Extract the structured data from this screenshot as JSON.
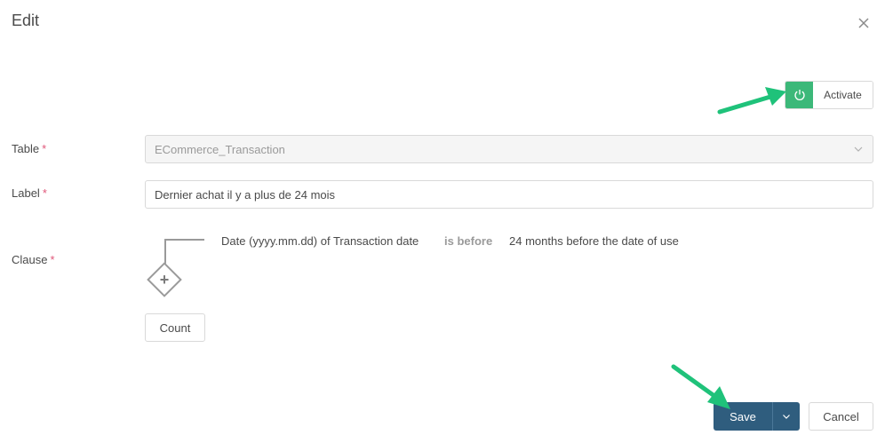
{
  "dialog": {
    "title": "Edit",
    "close_icon": "close-icon"
  },
  "activate": {
    "icon": "power-icon",
    "label": "Activate",
    "accent": "#3cb879"
  },
  "form": {
    "table": {
      "label": "Table",
      "required_mark": "*",
      "value": "ECommerce_Transaction"
    },
    "label_field": {
      "label": "Label",
      "required_mark": "*",
      "value": "Dernier achat il y a plus de 24 mois"
    },
    "clause": {
      "label": "Clause",
      "required_mark": "*",
      "field": "Date (yyyy.mm.dd) of Transaction date",
      "operator": "is before",
      "value": "24 months before the date of use",
      "add_icon": "plus-diamond-icon"
    },
    "count_button": "Count"
  },
  "footer": {
    "save_label": "Save",
    "cancel_label": "Cancel",
    "save_color": "#2f5d7e"
  },
  "annotations": {
    "arrow_color": "#1fc27a"
  }
}
